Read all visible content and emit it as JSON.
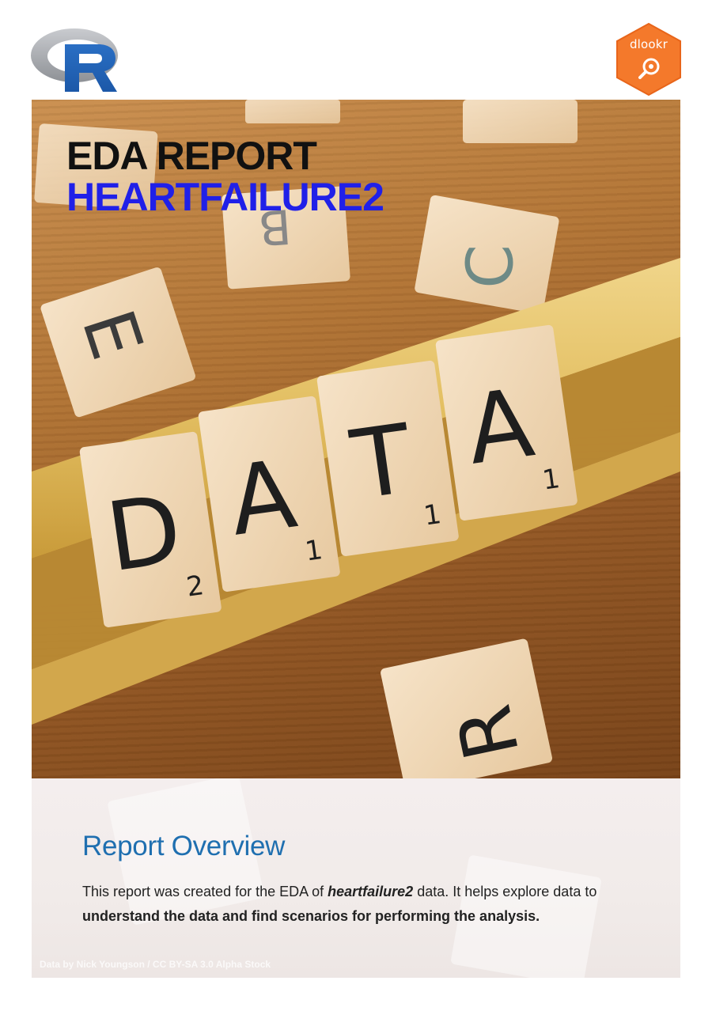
{
  "logos": {
    "left_icon": "r-language-logo-icon",
    "right_label": "dlookr",
    "right_icon": "magnifier-icon",
    "right_color": "#f4792b"
  },
  "cover": {
    "title": "EDA REPORT",
    "subtitle": "HEARTFAILURE2",
    "subtitle_color": "#2020e8",
    "photo": "scrabble-tiles-data-photo"
  },
  "overview": {
    "heading": "Report Overview",
    "sentence_start": "This report was created for the EDA of ",
    "dataset_name": "heartfailure2",
    "sentence_mid": " data. It helps explore data to ",
    "sentence_bold": "understand the data and find scenarios for performing the analysis.",
    "photo_credit": "Data by Nick Youngson / CC BY-SA 3.0 Alpha Stock"
  },
  "colors": {
    "heading": "#1f6fb0",
    "text": "#222222"
  }
}
